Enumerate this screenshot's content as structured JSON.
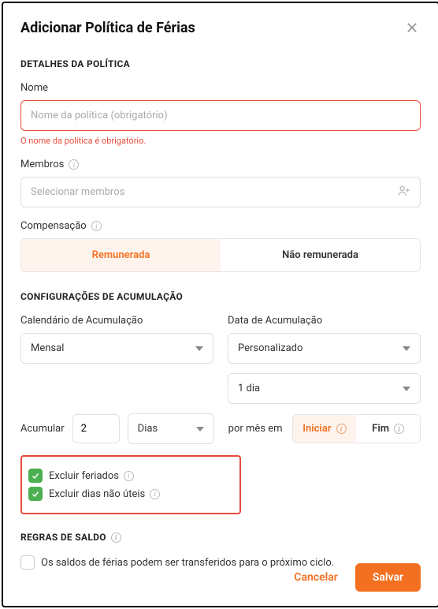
{
  "modal": {
    "title": "Adicionar Política de Férias"
  },
  "policyDetails": {
    "sectionTitle": "DETALHES DA POLÍTICA",
    "name": {
      "label": "Nome",
      "placeholder": "Nome da política (obrigatório)",
      "value": "",
      "error": "O nome da política é obrigatório."
    },
    "members": {
      "label": "Membros",
      "placeholder": "Selecionar membros"
    },
    "compensation": {
      "label": "Compensação",
      "options": [
        "Remunerada",
        "Não remunerada"
      ],
      "selectedIndex": 0
    }
  },
  "accrual": {
    "sectionTitle": "CONFIGURAÇÕES DE ACUMULAÇÃO",
    "schedule": {
      "label": "Calendário de Acumulação",
      "value": "Mensal"
    },
    "date": {
      "label": "Data de Acumulação",
      "value": "Personalizado",
      "dayValue": "1 dia"
    },
    "accrue": {
      "label": "Acumular",
      "amount": "2",
      "unit": "Dias",
      "perLabel": "por mês em",
      "timing": {
        "options": [
          "Iniciar",
          "Fim"
        ],
        "selectedIndex": 0
      }
    },
    "excludeHolidays": {
      "label": "Excluir feriados",
      "checked": true
    },
    "excludeNonWorking": {
      "label": "Excluir dias não úteis",
      "checked": true
    }
  },
  "balance": {
    "sectionTitle": "REGRAS DE SALDO",
    "carryOver": {
      "label": "Os saldos de férias podem ser transferidos para o próximo ciclo.",
      "checked": false
    }
  },
  "footer": {
    "cancel": "Cancelar",
    "save": "Salvar"
  }
}
